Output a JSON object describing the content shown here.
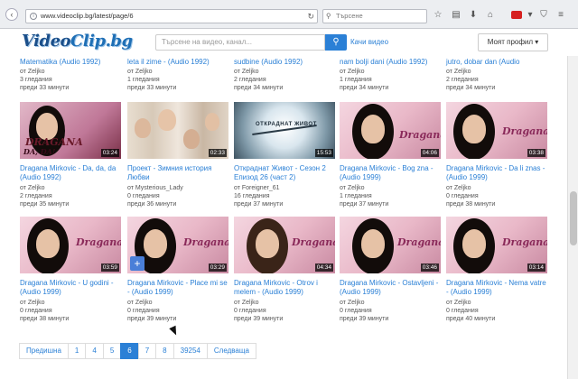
{
  "browser": {
    "url": "www.videoclip.bg/latest/page/6",
    "search_placeholder": "Търсене"
  },
  "site": {
    "logo_part1": "Video",
    "logo_part2": "Clip.bg",
    "search_placeholder": "Търсене на видео, канал...",
    "upload_label": "Качи видео",
    "profile_label": "Моят профил ▾"
  },
  "partial_row": [
    {
      "title": "Matematika (Audio 1992)",
      "author": "от Zeljko",
      "views": "3 гледания",
      "time": "преди 33 минути"
    },
    {
      "title": "leta il zime - (Audio 1992)",
      "author": "от Zeljko",
      "views": "1 гледания",
      "time": "преди 33 минути"
    },
    {
      "title": "sudbine (Audio 1992)",
      "author": "от Zeljko",
      "views": "2 гледания",
      "time": "преди 34 минути"
    },
    {
      "title": "nam bolji dani (Audio 1992)",
      "author": "от Zeljko",
      "views": "1 гледания",
      "time": "преди 34 минути"
    },
    {
      "title": "jutro, dobar dan (Audio",
      "author": "от Zeljko",
      "views": "2 гледания",
      "time": "преди 34 минути"
    }
  ],
  "row1": [
    {
      "duration": "03:24",
      "title": "Dragana Mirkovic - Da, da, da (Audio 1992)",
      "author": "от Zeljko",
      "views": "2 гледания",
      "time": "преди 35 минути"
    },
    {
      "duration": "02:33",
      "title": "Проект - Зимния история Любви",
      "author": "от Mysterious_Lady",
      "views": "0 гледания",
      "time": "преди 36 минути"
    },
    {
      "duration": "15:53",
      "title": "Откраднат Живот - Сезон 2 Епизод 26 (част 2)",
      "author": "от Foreigner_61",
      "views": "16 гледания",
      "time": "преди 37 минути"
    },
    {
      "duration": "04:06",
      "title": "Dragana Mirkovic - Bog zna - (Audio 1999)",
      "author": "от Zeljko",
      "views": "1 гледания",
      "time": "преди 37 минути"
    },
    {
      "duration": "03:38",
      "title": "Dragana Mirkovic - Da li znas - (Audio 1999)",
      "author": "от Zeljko",
      "views": "0 гледания",
      "time": "преди 38 минути"
    }
  ],
  "row2": [
    {
      "duration": "03:59",
      "title": "Dragana Mirkovic - U godini - (Audio 1999)",
      "author": "от Zeljko",
      "views": "0 гледания",
      "time": "преди 38 минути"
    },
    {
      "duration": "03:29",
      "title": "Dragana Mirkovic - Place mi se - (Audio 1999)",
      "author": "от Zeljko",
      "views": "0 гледания",
      "time": "преди 39 минути"
    },
    {
      "duration": "04:34",
      "title": "Dragana Mirkovic - Otrov i melem - (Audio 1999)",
      "author": "от Zeljko",
      "views": "0 гледания",
      "time": "преди 39 минути"
    },
    {
      "duration": "03:46",
      "title": "Dragana Mirkovic - Ostavljeni - (Audio 1999)",
      "author": "от Zeljko",
      "views": "0 гледания",
      "time": "преди 39 минути"
    },
    {
      "duration": "03:14",
      "title": "Dragana Mirkovic - Nema vatre - (Audio 1999)",
      "author": "от Zeljko",
      "views": "0 гледания",
      "time": "преди 40 минути"
    }
  ],
  "thumb_text": {
    "dragana": "DRAGANA",
    "da_da": "DA, DA!",
    "otkradnat": "ОТКРАДНАТ ЖИВОТ",
    "dragana_script": "Dragana"
  },
  "pagination": {
    "prev": "Предишна",
    "pages": [
      "1",
      "4",
      "5",
      "6",
      "7",
      "8",
      "39254"
    ],
    "next": "Следваща",
    "current": "6"
  },
  "colors": {
    "accent": "#2b80d6",
    "logo": "#1f6fb5"
  }
}
